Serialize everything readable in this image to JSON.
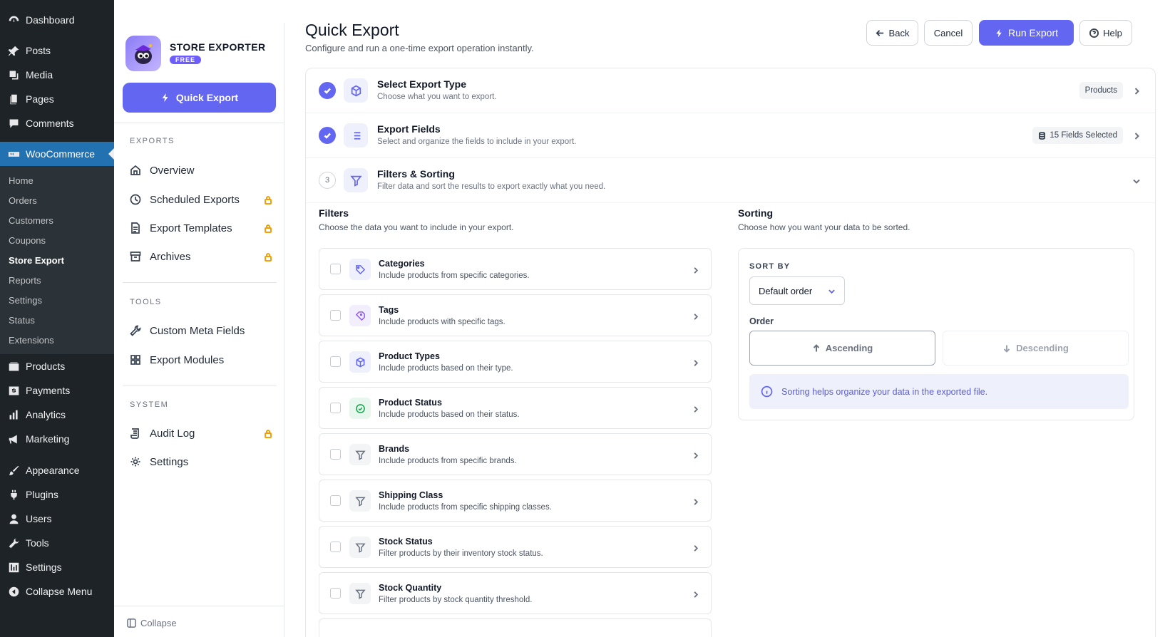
{
  "wp_menu": {
    "top": [
      {
        "label": "Dashboard",
        "icon": "dashboard-icon"
      },
      {
        "label": "Posts",
        "icon": "pin-icon"
      },
      {
        "label": "Media",
        "icon": "media-icon"
      },
      {
        "label": "Pages",
        "icon": "pages-icon"
      },
      {
        "label": "Comments",
        "icon": "comments-icon"
      }
    ],
    "woocommerce": {
      "label": "WooCommerce",
      "icon": "woocommerce-icon"
    },
    "woo_sub": [
      "Home",
      "Orders",
      "Customers",
      "Coupons",
      "Store Export",
      "Reports",
      "Settings",
      "Status",
      "Extensions"
    ],
    "bottom": [
      {
        "label": "Products",
        "icon": "products-icon"
      },
      {
        "label": "Payments",
        "icon": "payments-icon"
      },
      {
        "label": "Analytics",
        "icon": "analytics-icon"
      },
      {
        "label": "Marketing",
        "icon": "megaphone-icon"
      },
      {
        "label": "Appearance",
        "icon": "brush-icon"
      },
      {
        "label": "Plugins",
        "icon": "plugin-icon"
      },
      {
        "label": "Users",
        "icon": "user-icon"
      },
      {
        "label": "Tools",
        "icon": "wrench-icon"
      },
      {
        "label": "Settings",
        "icon": "settings-icon"
      },
      {
        "label": "Collapse Menu",
        "icon": "collapse-icon"
      }
    ]
  },
  "plugin": {
    "brand_title": "STORE EXPORTER",
    "badge": "FREE",
    "quick_export_label": "Quick Export",
    "sections": {
      "exports": "EXPORTS",
      "tools": "TOOLS",
      "system": "SYSTEM"
    },
    "exports_items": [
      "Overview",
      "Scheduled Exports",
      "Export Templates",
      "Archives"
    ],
    "tools_items": [
      "Custom Meta Fields",
      "Export Modules"
    ],
    "system_items": [
      "Audit Log",
      "Settings"
    ],
    "collapse_label": "Collapse"
  },
  "header": {
    "title": "Quick Export",
    "subtitle": "Configure and run a one-time export operation instantly.",
    "back": "Back",
    "cancel": "Cancel",
    "run": "Run Export",
    "help": "Help"
  },
  "steps": [
    {
      "title": "Select Export Type",
      "desc": "Choose what you want to export.",
      "badge": "Products"
    },
    {
      "title": "Export Fields",
      "desc": "Select and organize the fields to include in your export.",
      "badge": "15 Fields Selected"
    },
    {
      "number": "3",
      "title": "Filters & Sorting",
      "desc": "Filter data and sort the results to export exactly what you need."
    }
  ],
  "filters": {
    "title": "Filters",
    "subtitle": "Choose the data you want to include in your export.",
    "items": [
      {
        "title": "Categories",
        "desc": "Include products from specific categories."
      },
      {
        "title": "Tags",
        "desc": "Include products with specific tags."
      },
      {
        "title": "Product Types",
        "desc": "Include products based on their type."
      },
      {
        "title": "Product Status",
        "desc": "Include products based on their status."
      },
      {
        "title": "Brands",
        "desc": "Include products from specific brands."
      },
      {
        "title": "Shipping Class",
        "desc": "Include products from specific shipping classes."
      },
      {
        "title": "Stock Status",
        "desc": "Filter products by their inventory stock status."
      },
      {
        "title": "Stock Quantity",
        "desc": "Filter products by stock quantity threshold."
      }
    ]
  },
  "sorting": {
    "title": "Sorting",
    "subtitle": "Choose how you want your data to be sorted.",
    "sort_by_label": "SORT BY",
    "sort_by_value": "Default order",
    "order_label": "Order",
    "ascending": "Ascending",
    "descending": "Descending",
    "info": "Sorting helps organize your data in the exported file."
  },
  "colors": {
    "accent": "#6366f1",
    "wp_sidebar": "#1d2327",
    "wp_active": "#2271b1",
    "lock": "#f59e0b"
  }
}
